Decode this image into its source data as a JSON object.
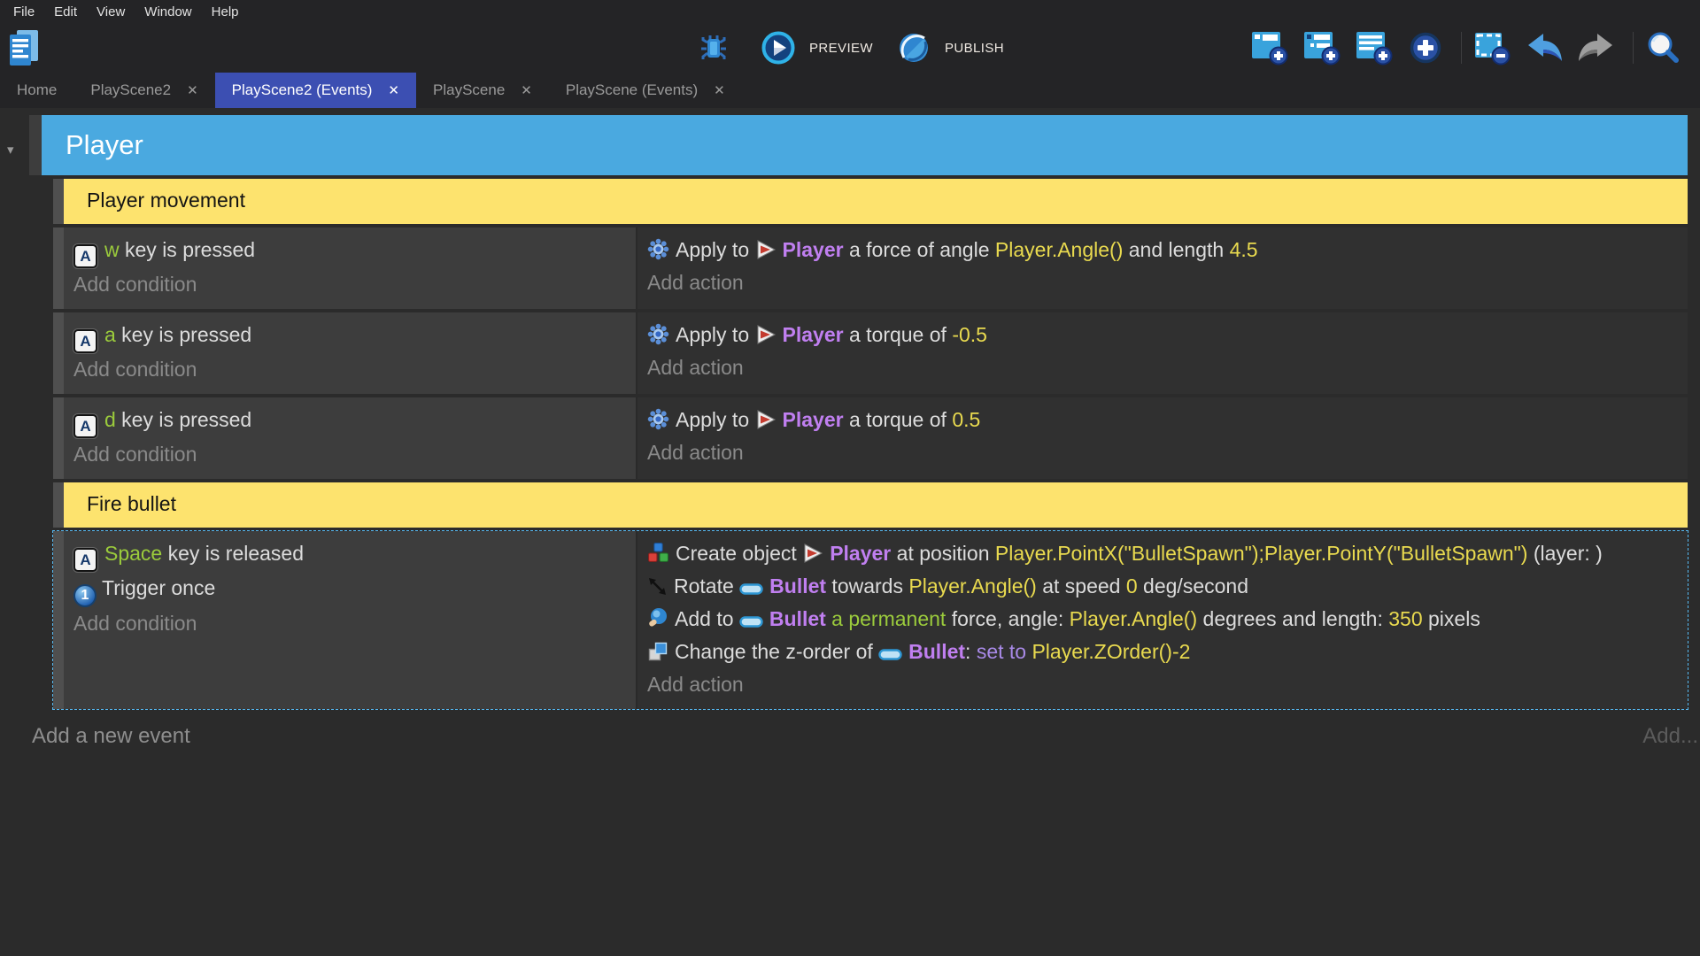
{
  "menu": {
    "items": [
      "File",
      "Edit",
      "View",
      "Window",
      "Help"
    ]
  },
  "toolbar": {
    "preview_label": "PREVIEW",
    "publish_label": "PUBLISH",
    "center_icons": [
      "debug-icon",
      "preview-icon",
      "publish-icon"
    ],
    "right_icons": [
      "add-event-icon",
      "add-subevent-icon",
      "add-comment-icon",
      "add-circle-icon",
      "separator",
      "delete-selection-icon",
      "undo-icon",
      "redo-icon",
      "separator",
      "search-icon"
    ]
  },
  "tabs": [
    {
      "label": "Home",
      "active": false,
      "closable": false
    },
    {
      "label": "PlayScene2",
      "active": false,
      "closable": true
    },
    {
      "label": "PlayScene2 (Events)",
      "active": true,
      "closable": true
    },
    {
      "label": "PlayScene",
      "active": false,
      "closable": true
    },
    {
      "label": "PlayScene (Events)",
      "active": false,
      "closable": true
    }
  ],
  "events": {
    "group_title": "Player",
    "add_condition_label": "Add condition",
    "add_action_label": "Add action",
    "add_new_event_label": "Add a new event",
    "add_more_label": "Add...",
    "rows": [
      {
        "type": "comment",
        "text": "Player movement"
      },
      {
        "type": "event",
        "selected": false,
        "conditions": [
          [
            {
              "icon": "keyboard-key-icon"
            },
            {
              "text": "w",
              "color": "green"
            },
            {
              "text": " key is pressed"
            }
          ]
        ],
        "actions": [
          [
            {
              "icon": "force-icon"
            },
            {
              "text": "Apply to "
            },
            {
              "icon": "player-object-icon"
            },
            {
              "text": "Player",
              "color": "object"
            },
            {
              "text": " a force of angle "
            },
            {
              "text": "Player.Angle()",
              "color": "expression"
            },
            {
              "text": " and length "
            },
            {
              "text": "4.5",
              "color": "expression"
            }
          ]
        ]
      },
      {
        "type": "event",
        "selected": false,
        "conditions": [
          [
            {
              "icon": "keyboard-key-icon"
            },
            {
              "text": "a",
              "color": "green"
            },
            {
              "text": " key is pressed"
            }
          ]
        ],
        "actions": [
          [
            {
              "icon": "force-icon"
            },
            {
              "text": "Apply to "
            },
            {
              "icon": "player-object-icon"
            },
            {
              "text": "Player",
              "color": "object"
            },
            {
              "text": " a torque of "
            },
            {
              "text": "-0.5",
              "color": "expression"
            }
          ]
        ]
      },
      {
        "type": "event",
        "selected": false,
        "conditions": [
          [
            {
              "icon": "keyboard-key-icon"
            },
            {
              "text": "d",
              "color": "green"
            },
            {
              "text": " key is pressed"
            }
          ]
        ],
        "actions": [
          [
            {
              "icon": "force-icon"
            },
            {
              "text": "Apply to "
            },
            {
              "icon": "player-object-icon"
            },
            {
              "text": "Player",
              "color": "object"
            },
            {
              "text": " a torque of "
            },
            {
              "text": "0.5",
              "color": "expression"
            }
          ]
        ]
      },
      {
        "type": "comment",
        "text": "Fire bullet"
      },
      {
        "type": "event",
        "selected": true,
        "conditions": [
          [
            {
              "icon": "keyboard-key-icon"
            },
            {
              "text": "Space",
              "color": "green"
            },
            {
              "text": " key is released"
            }
          ],
          [
            {
              "icon": "trigger-once-icon"
            },
            {
              "text": "Trigger once"
            }
          ]
        ],
        "actions": [
          [
            {
              "icon": "create-object-icon"
            },
            {
              "text": "Create object "
            },
            {
              "icon": "player-object-icon"
            },
            {
              "text": "Player",
              "color": "object"
            },
            {
              "text": " at position "
            },
            {
              "text": "Player.PointX(\"BulletSpawn\");Player.PointY(\"BulletSpawn\")",
              "color": "expression"
            },
            {
              "text": " (layer: )"
            }
          ],
          [
            {
              "icon": "rotate-icon"
            },
            {
              "text": "Rotate "
            },
            {
              "icon": "bullet-object-icon"
            },
            {
              "text": "Bullet",
              "color": "object"
            },
            {
              "text": " towards "
            },
            {
              "text": "Player.Angle()",
              "color": "expression"
            },
            {
              "text": " at speed "
            },
            {
              "text": "0",
              "color": "expression"
            },
            {
              "text": " deg/second"
            }
          ],
          [
            {
              "icon": "add-force-icon"
            },
            {
              "text": "Add to "
            },
            {
              "icon": "bullet-object-icon"
            },
            {
              "text": "Bullet",
              "color": "object"
            },
            {
              "text": " a permanent",
              "color": "green"
            },
            {
              "text": " force, angle: "
            },
            {
              "text": "Player.Angle()",
              "color": "expression"
            },
            {
              "text": " degrees and length: "
            },
            {
              "text": "350",
              "color": "expression"
            },
            {
              "text": " pixels"
            }
          ],
          [
            {
              "icon": "zorder-icon"
            },
            {
              "text": "Change the z-order of "
            },
            {
              "icon": "bullet-object-icon"
            },
            {
              "text": "Bullet",
              "color": "object"
            },
            {
              "text": ": "
            },
            {
              "text": "set to ",
              "color": "operator"
            },
            {
              "text": "Player.ZOrder()-2",
              "color": "expression"
            }
          ]
        ]
      }
    ]
  },
  "colors": {
    "chrome_bg": "#242426",
    "sheet_bg": "#2b2b2b",
    "group_header_blue": "#4aa9e0",
    "comment_yellow": "#fde36e",
    "active_tab_indigo": "#3c4fb2",
    "condition_cell": "#3d3d3d",
    "action_cell": "#303030",
    "object_name_purple": "#c07ff0",
    "expression_yellow": "#e9da4f",
    "key_green": "#9bcb3c",
    "operator_purple": "#a98ae8",
    "selection_border": "#56b8f0"
  }
}
